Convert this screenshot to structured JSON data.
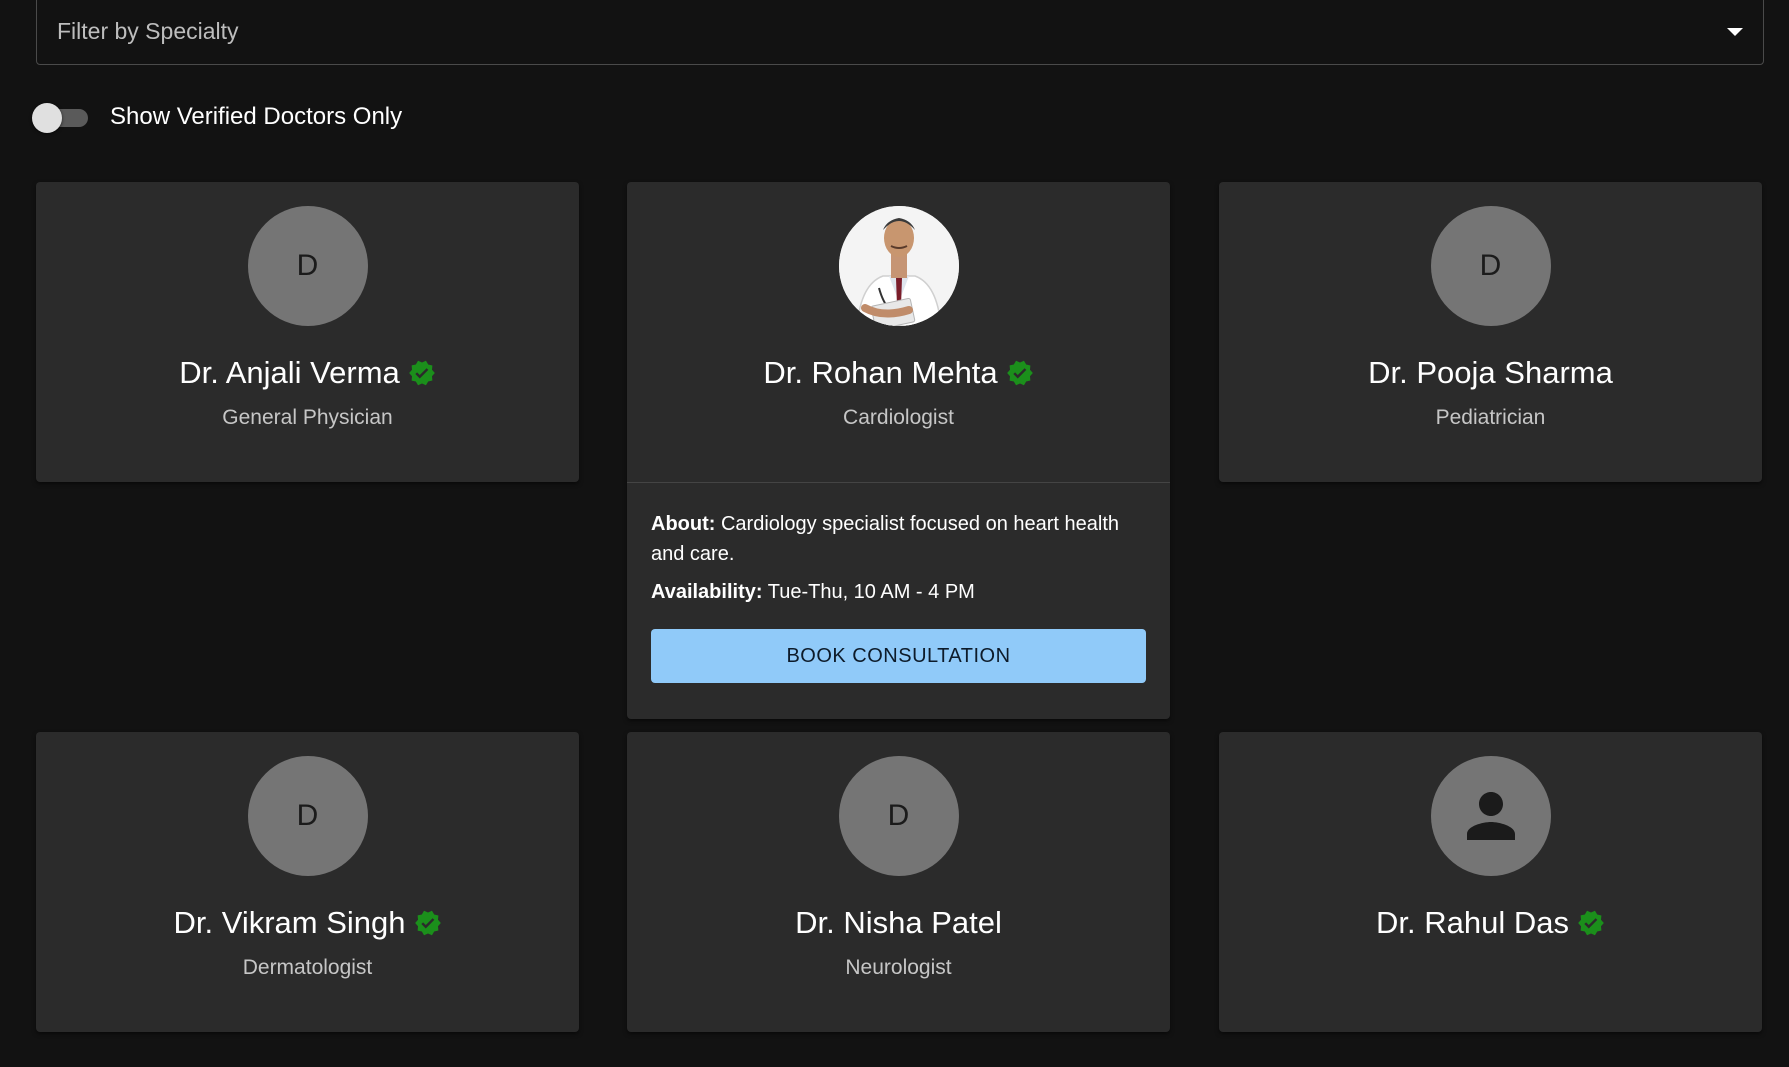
{
  "filter": {
    "label": "Filter by Specialty"
  },
  "toggle": {
    "label": "Show Verified Doctors Only",
    "checked": false
  },
  "colors": {
    "accent": "#90caf9",
    "verified": "#1b8f1b",
    "card": "#2b2b2b",
    "background": "#121212"
  },
  "doctors": [
    {
      "name": "Dr. Anjali Verma",
      "specialty": "General Physician",
      "avatar_letter": "D",
      "verified": true
    },
    {
      "name": "Dr. Rohan Mehta",
      "specialty": "Cardiologist",
      "avatar": "photo",
      "verified": true,
      "about_label": "About:",
      "about": "Cardiology specialist focused on heart health and care.",
      "availability_label": "Availability:",
      "availability": "Tue-Thu, 10 AM - 4 PM",
      "button_label": "BOOK CONSULTATION"
    },
    {
      "name": "Dr. Pooja Sharma",
      "specialty": "Pediatrician",
      "avatar_letter": "D",
      "verified": false
    },
    {
      "name": "Dr. Vikram Singh",
      "specialty": "Dermatologist",
      "avatar_letter": "D",
      "verified": true
    },
    {
      "name": "Dr. Nisha Patel",
      "specialty": "Neurologist",
      "avatar_letter": "D",
      "verified": false
    },
    {
      "name": "Dr. Rahul Das",
      "specialty": "",
      "avatar": "person-icon",
      "verified": true
    }
  ]
}
